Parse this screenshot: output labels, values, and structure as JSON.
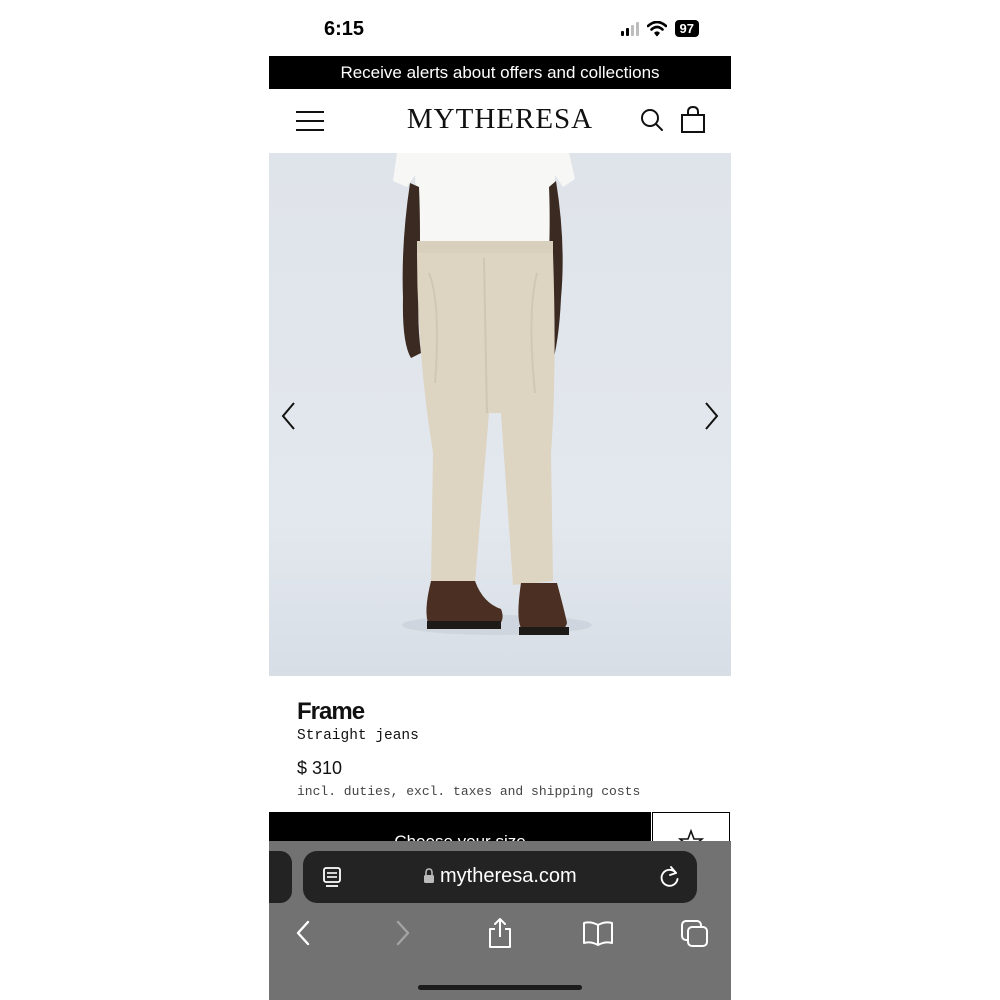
{
  "status_bar": {
    "time": "6:15",
    "battery": "97"
  },
  "promo": {
    "text": "Receive alerts about offers and collections"
  },
  "header": {
    "logo": "MYTHERESA",
    "icons": [
      "menu-icon",
      "search-icon",
      "bag-icon"
    ]
  },
  "gallery": {
    "icons": [
      "chevron-left-icon",
      "chevron-right-icon"
    ]
  },
  "product": {
    "brand": "Frame",
    "name": "Straight jeans",
    "price": "$ 310",
    "price_note": "incl. duties, excl. taxes and shipping costs",
    "size_button": "Choose your size"
  },
  "browser": {
    "url": "mytheresa.com",
    "icons": [
      "reader-icon",
      "lock-icon",
      "reload-icon",
      "back-icon",
      "forward-icon",
      "share-icon",
      "bookmarks-icon",
      "tabs-icon"
    ]
  },
  "colors": {
    "promo_bg": "#000000",
    "image_bg": "#e0e5eb",
    "safari_bg": "#727272"
  }
}
